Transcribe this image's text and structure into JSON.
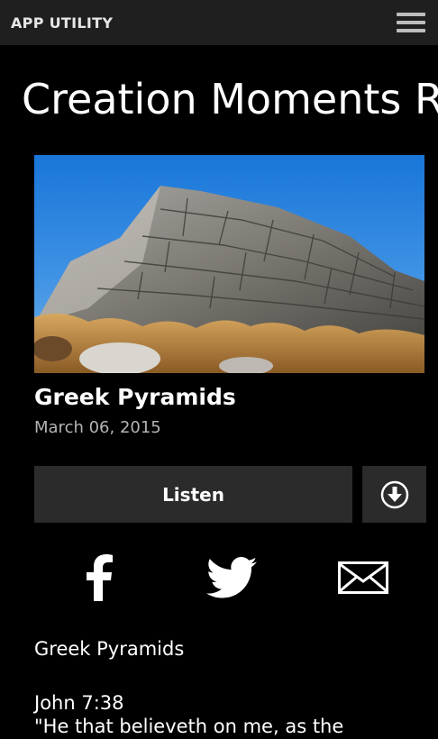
{
  "app": {
    "title": "APP UTILITY",
    "menu_icon": "hamburger-menu-icon"
  },
  "page": {
    "title": "Creation Moments Radio"
  },
  "article": {
    "image_icon": "stone-pyramid-photo",
    "title": "Greek Pyramids",
    "date": "March 06, 2015",
    "listen_label": "Listen",
    "download_icon": "download-circle-icon"
  },
  "share": {
    "facebook_icon": "facebook-icon",
    "twitter_icon": "twitter-icon",
    "email_icon": "email-icon"
  },
  "body": {
    "heading": "Greek Pyramids",
    "reference": "John 7:38",
    "quote": "\"He that believeth on me, as the"
  },
  "colors": {
    "background": "#000000",
    "appbar": "#1f1f1f",
    "button": "#2b2b2b",
    "date_text": "#b4b4b4"
  }
}
